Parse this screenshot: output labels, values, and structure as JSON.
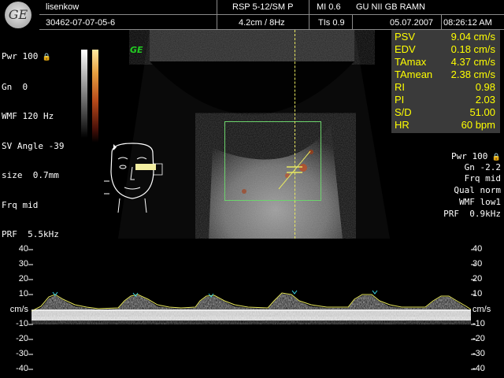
{
  "header": {
    "operator": "lisenkow",
    "patient_id": "30462-07-07-05-6",
    "probe": "RSP 5-12/SM P",
    "depth_freq": "4.2cm / 8Hz",
    "mi": "MI  0.6",
    "tis": "TIs  0.9",
    "institution": "GU NII GB RAMN",
    "date": "05.07.2007",
    "time": "08:26:12 AM"
  },
  "brand": {
    "logo_text": "GE",
    "mark": "GE"
  },
  "left_params": [
    "Pwr 100",
    "Gn  0",
    "WMF 120 Hz",
    "SV Angle -39",
    "size  0.7mm",
    "Frq mid",
    "PRF  5.5kHz"
  ],
  "measurements": [
    {
      "key": "PSV",
      "value": "9.04 cm/s"
    },
    {
      "key": "EDV",
      "value": "0.18 cm/s"
    },
    {
      "key": "TAmax",
      "value": "4.37 cm/s"
    },
    {
      "key": "TAmean",
      "value": "2.38 cm/s"
    },
    {
      "key": "RI",
      "value": "0.98"
    },
    {
      "key": "PI",
      "value": "2.03"
    },
    {
      "key": "S/D",
      "value": "51.00"
    },
    {
      "key": "HR",
      "value": "60 bpm"
    }
  ],
  "right_params": [
    "Pwr 100",
    "Gn -2.2",
    "Frq mid",
    "Qual norm",
    "WMF low1",
    "PRF  0.9kHz"
  ],
  "scale": {
    "unit": "cm/s",
    "ticks": [
      "40",
      "30",
      "20",
      "10",
      "",
      "-10",
      "-20",
      "-30",
      "-40"
    ]
  },
  "colors": {
    "measure_text": "#ffff00",
    "measure_bg": "#3a3a3a",
    "roi_box": "#6cd36c",
    "brand": "#22cc22"
  }
}
